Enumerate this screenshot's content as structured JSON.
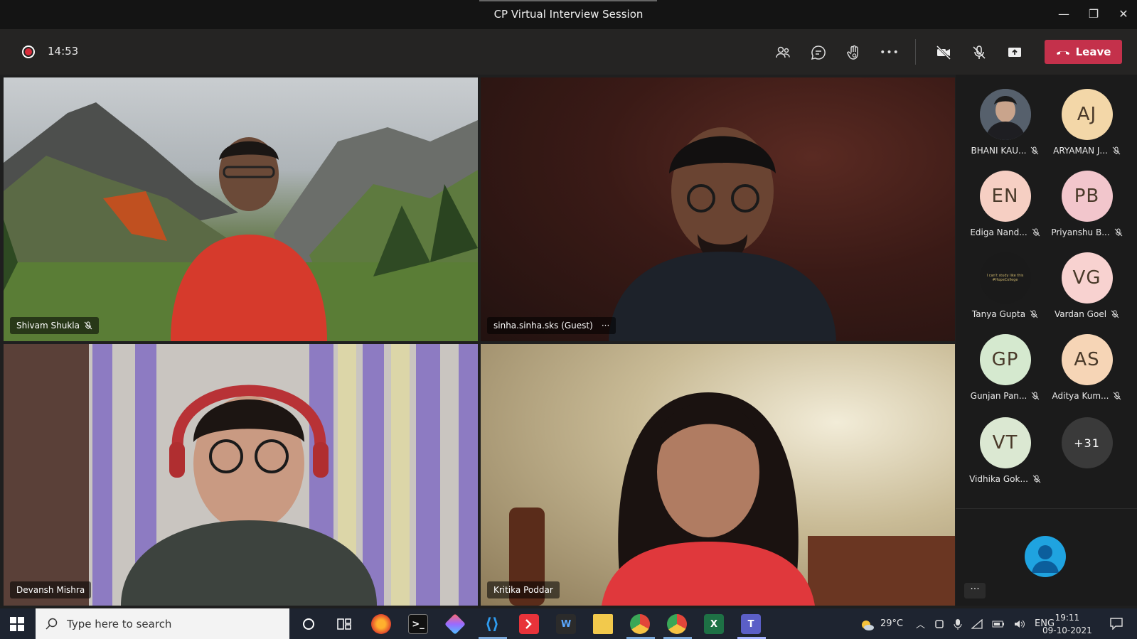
{
  "window": {
    "title": "CP Virtual Interview Session",
    "minimize_glyph": "—",
    "restore_glyph": "❐",
    "close_glyph": "✕"
  },
  "meeting": {
    "elapsed": "14:53",
    "leave_label": "Leave",
    "more_glyph": "•••"
  },
  "videos": [
    {
      "name": "Shivam Shukla",
      "muted": true
    },
    {
      "name": "sinha.sinha.sks (Guest)",
      "menu": "···"
    },
    {
      "name": "Devansh Mishra"
    },
    {
      "name": "Kritika Poddar"
    }
  ],
  "roster": [
    {
      "name": "BHANI KAU...",
      "initials": "",
      "color": "#3a3f48"
    },
    {
      "name": "ARYAMAN J...",
      "initials": "AJ",
      "color": "#f3d7a8"
    },
    {
      "name": "Ediga Nand...",
      "initials": "EN",
      "color": "#f6cfc3"
    },
    {
      "name": "Priyanshu B...",
      "initials": "PB",
      "color": "#f2c6cc"
    },
    {
      "name": "Tanya Gupta",
      "initials": "",
      "color": "#1a1a1a",
      "image_text": "I can't study like this #HopeCollege"
    },
    {
      "name": "Vardan Goel",
      "initials": "VG",
      "color": "#f8d2d0"
    },
    {
      "name": "Gunjan Pan...",
      "initials": "GP",
      "color": "#d5e9cf"
    },
    {
      "name": "Aditya Kum...",
      "initials": "AS",
      "color": "#f6d5b6"
    },
    {
      "name": "Vidhika Gok...",
      "initials": "VT",
      "color": "#dbe8d2"
    },
    {
      "name": "",
      "initials": "+31",
      "color": "#3a3a3a"
    }
  ],
  "self_view": {
    "more_glyph": "···"
  },
  "taskbar": {
    "search_placeholder": "Type here to search",
    "weather": "29°C",
    "language": "ENG",
    "time": "19:11",
    "date": "09-10-2021"
  }
}
